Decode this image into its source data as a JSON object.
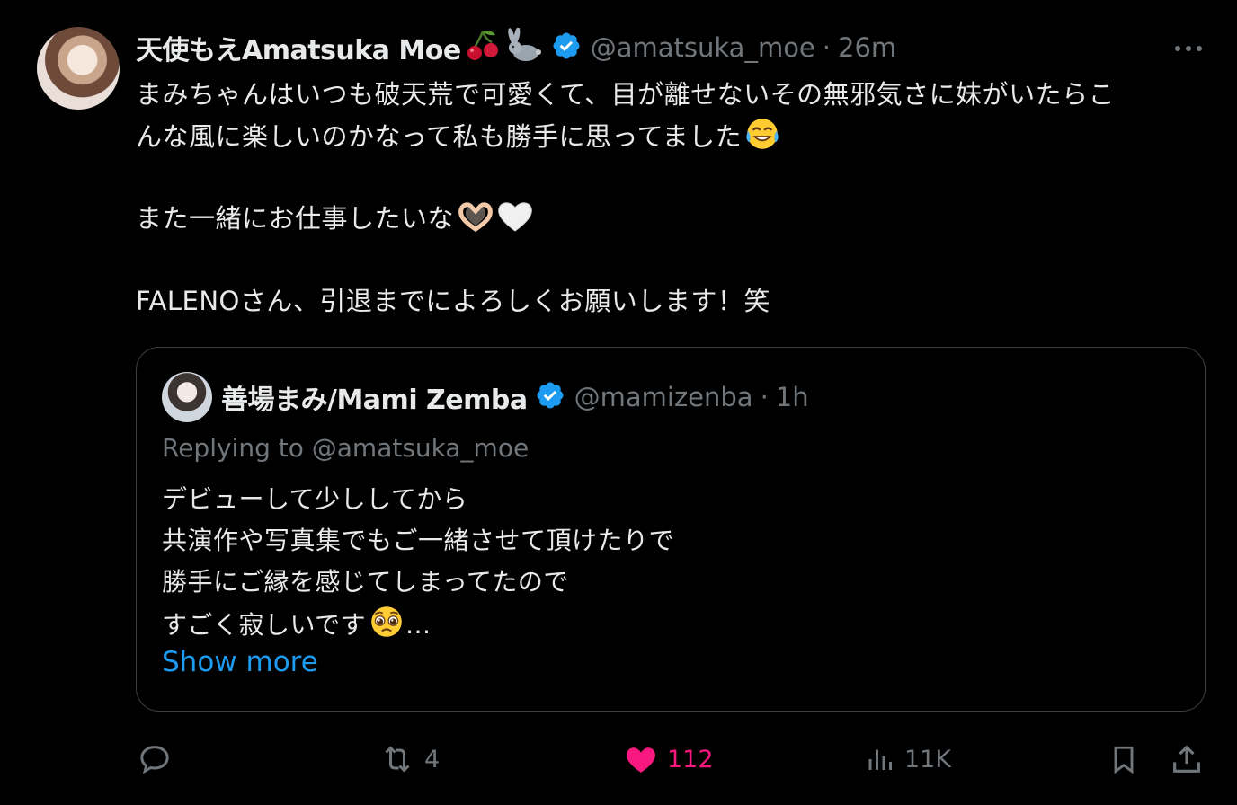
{
  "tweet": {
    "author_name": "天使もえAmatsuka Moe",
    "name_emojis": [
      "cherry-icon",
      "rabbit-icon"
    ],
    "handle": "@amatsuka_moe",
    "time": "26m",
    "separator": "·",
    "body_lines": [
      "まみちゃんはいつも破天荒で可愛くて、目が離せないその無邪気さに妹がいたらこ",
      "んな風に楽しいのかなって私も勝手に思ってました",
      "",
      "また一緒にお仕事したいな",
      "",
      "FALENOさん、引退までによろしくお願いします！笑"
    ]
  },
  "quote": {
    "author_name": "善場まみ/Mami Zemba",
    "handle": "@mamizenba",
    "time": "1h",
    "separator": "·",
    "replying_to": "Replying to @amatsuka_moe",
    "body_lines": [
      "デビューして少ししてから",
      "共演作や写真集でもご一緒させて頂けたりで",
      "勝手にご縁を感じてしまってたので",
      "すごく寂しいです"
    ],
    "ellipsis": "...",
    "show_more": "Show more"
  },
  "actions": {
    "reply_count": "",
    "retweet_count": "4",
    "like_count": "112",
    "views_count": "11K"
  },
  "colors": {
    "accent": "#1d9bf0",
    "like": "#f91880",
    "muted": "#71767b",
    "text": "#e7e9ea",
    "background": "#000000"
  }
}
